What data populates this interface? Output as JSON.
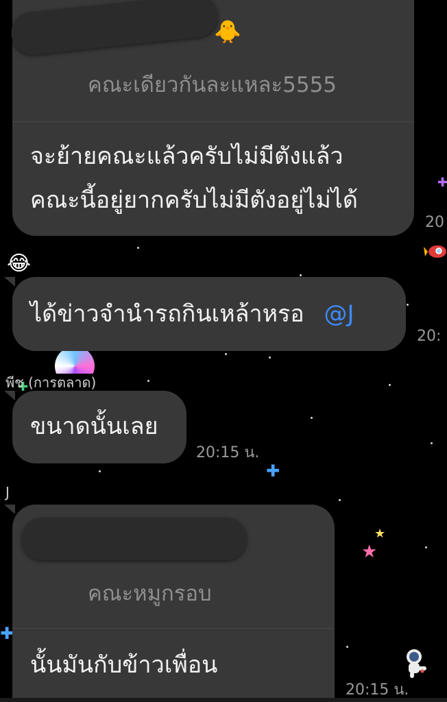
{
  "messages": [
    {
      "quote_text": "คณะเดียวกันละแหละ5555",
      "lines": [
        "จะย้ายคณะแล้วครับไม่มีตังแล้ว",
        "คณะนี้อยู่ยากครับไม่มีตังอยู่ไม่ได้"
      ],
      "time": "20"
    },
    {
      "text": "ได้ข่าวจำนำรถกินเหล้าหรอ",
      "mention": "@J",
      "time": "20:"
    },
    {
      "sender": "พีช (การตลาด)",
      "text": "ขนาดนั้นเลย",
      "time": "20:15 น."
    },
    {
      "sender": "J",
      "quote_text": "คณะหมูกรอบ",
      "text": "นั้นมันกับข้าวเพื่อน",
      "time": "20:15 น."
    }
  ],
  "decor": {
    "laugh_emoji": "😂",
    "chick_emoji": "🐥",
    "sparkle_plus": "✚",
    "star_glyph": "★",
    "rocket_icon": "rocket-sticker",
    "astronaut_icon": "astronaut-sticker",
    "colors": {
      "bubble": "#383838",
      "mention": "#3b8cff",
      "background": "#000000"
    }
  }
}
